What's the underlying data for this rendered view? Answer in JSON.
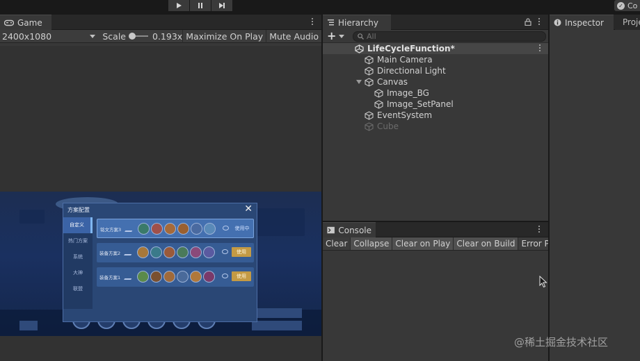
{
  "toolbar": {
    "collab_label": "Co"
  },
  "game": {
    "tab_label": "Game",
    "resolution": "2400x1080",
    "scale_label": "Scale",
    "scale_value": "0.193x",
    "maximize_label": "Maximize On Play",
    "mute_label": "Mute Audio",
    "screen": {
      "dialog_title": "方案配置",
      "close_glyph": "✕",
      "side_items": [
        "自定义",
        "热门方案",
        "系统",
        "大神",
        "联盟"
      ],
      "rows": [
        {
          "label": "铭文方案3",
          "action": "使用中"
        },
        {
          "label": "装备方案2",
          "action": "使用"
        },
        {
          "label": "装备方案1",
          "action": "使用"
        }
      ]
    }
  },
  "hierarchy": {
    "tab_label": "Hierarchy",
    "search_placeholder": "All",
    "items": [
      {
        "label": "LifeCycleFunction*",
        "depth": 0,
        "kind": "scene"
      },
      {
        "label": "Main Camera",
        "depth": 1,
        "kind": "object"
      },
      {
        "label": "Directional Light",
        "depth": 1,
        "kind": "object"
      },
      {
        "label": "Canvas",
        "depth": 1,
        "kind": "object",
        "expanded": true
      },
      {
        "label": "Image_BG",
        "depth": 2,
        "kind": "object"
      },
      {
        "label": "Image_SetPanel",
        "depth": 2,
        "kind": "object"
      },
      {
        "label": "EventSystem",
        "depth": 1,
        "kind": "object"
      },
      {
        "label": "Cube",
        "depth": 1,
        "kind": "disabled"
      }
    ]
  },
  "console": {
    "tab_label": "Console",
    "buttons": [
      "Clear",
      "Collapse",
      "Clear on Play",
      "Clear on Build",
      "Error Pause"
    ]
  },
  "inspector": {
    "tab_label": "Inspector",
    "tab2_label": "Project Settings"
  },
  "watermark": "@稀土掘金技术社区",
  "colors": {
    "panel": "#383838",
    "tabbar": "#282828",
    "text": "#d2d2d2",
    "disabled": "#6c6c6c",
    "gold": "#c49a44"
  }
}
